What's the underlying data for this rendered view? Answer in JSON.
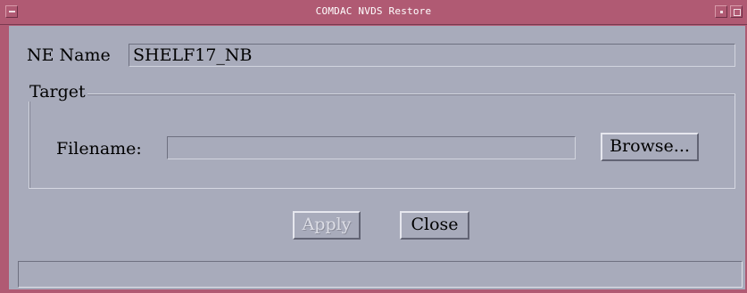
{
  "window": {
    "title": "COMDAC NVDS Restore"
  },
  "ne_name": {
    "label": "NE Name",
    "value": "SHELF17_NB"
  },
  "target_group": {
    "label": "Target",
    "filename_label": "Filename:",
    "filename_value": "",
    "browse_label": "Browse..."
  },
  "actions": {
    "apply_label": "Apply",
    "apply_enabled": false,
    "close_label": "Close"
  },
  "status": {
    "text": ""
  },
  "icons": {
    "window_menu": "window-menu-icon",
    "minimize": "minimize-icon",
    "maximize": "maximize-icon"
  },
  "colors": {
    "titlebar": "#b05a73",
    "background": "#a8abbb"
  }
}
